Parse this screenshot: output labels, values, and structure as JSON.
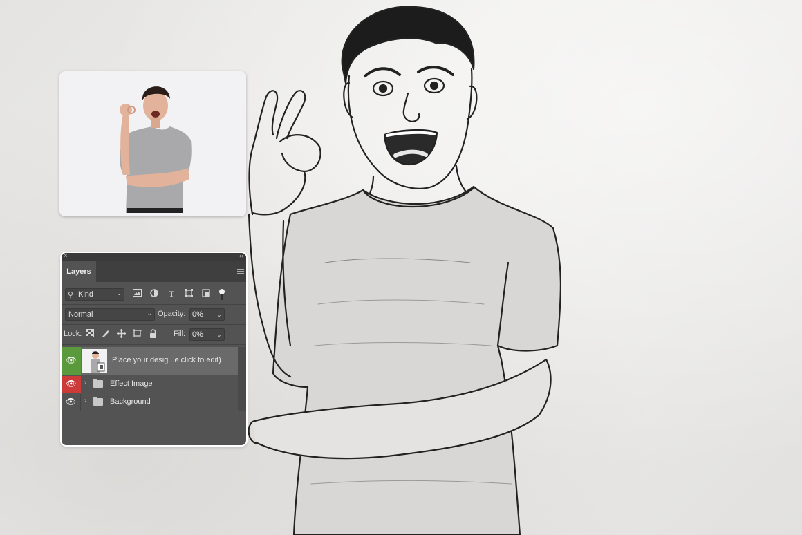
{
  "colors": {
    "panel_bg": "#535353",
    "eye_visible_green": "#5a9a3c",
    "eye_visible_red": "#cc3a3a",
    "selected_layer": "#6a6a6a"
  },
  "layers_panel": {
    "tab_label": "Layers",
    "close_glyph": "×",
    "collapse_glyph": "‹‹",
    "filter": {
      "kind_label": "Kind",
      "icons": [
        "image-filter-icon",
        "adjustment-filter-icon",
        "type-filter-icon",
        "shape-filter-icon",
        "smart-object-filter-icon",
        "filter-toggle-icon"
      ]
    },
    "blend_mode": "Normal",
    "opacity_label": "Opacity:",
    "opacity_value": "0%",
    "lock_label": "Lock:",
    "lock_icons": [
      "lock-transparent-pixels-icon",
      "lock-image-pixels-icon",
      "lock-position-icon",
      "lock-artboard-icon",
      "lock-all-icon"
    ],
    "fill_label": "Fill:",
    "fill_value": "0%",
    "layers": [
      {
        "name": "Place your desig...e click to edit)",
        "type": "smart-object",
        "selected": true,
        "eye_color": "green"
      },
      {
        "name": "Effect Image",
        "type": "group",
        "selected": false,
        "eye_color": "red"
      },
      {
        "name": "Background",
        "type": "group",
        "selected": false,
        "eye_color": "none"
      }
    ]
  }
}
